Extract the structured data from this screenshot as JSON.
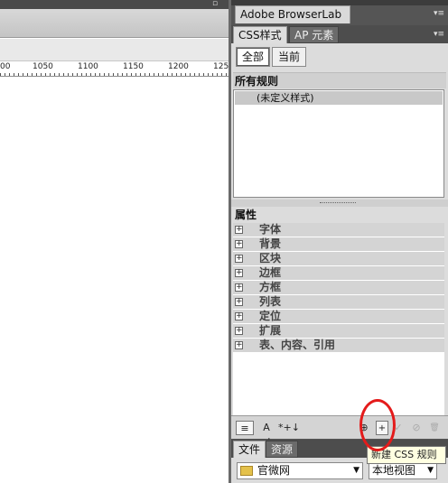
{
  "ruler": {
    "labels": [
      "00",
      "1050",
      "1100",
      "1150",
      "1200",
      "125"
    ]
  },
  "panel": {
    "browserlab_tab": "Adobe BrowserLab",
    "tabs": [
      "CSS样式",
      "AP 元素"
    ],
    "mode_buttons": [
      "全部",
      "当前"
    ],
    "rules_header": "所有规则",
    "rules_items": [
      "(未定义样式)"
    ],
    "properties_header": "属性",
    "properties": [
      "字体",
      "背景",
      "区块",
      "边框",
      "方框",
      "列表",
      "定位",
      "扩展",
      "表、内容、引用"
    ],
    "bottom_icons": {
      "show_list": "≡",
      "sort_az": "A z↓",
      "sort_set": "*+↓",
      "attach": "⊕",
      "new_rule": "+",
      "edit": "✓",
      "disable": "⊘",
      "delete": "🗑"
    }
  },
  "files": {
    "tabs": [
      "文件",
      "资源"
    ],
    "site_select": "官微网",
    "view_select": "本地视图"
  },
  "tooltip": {
    "text": "新建 CSS 规则"
  },
  "colors": {
    "annotation": "#e41b1b",
    "panel_bg": "#555555"
  }
}
